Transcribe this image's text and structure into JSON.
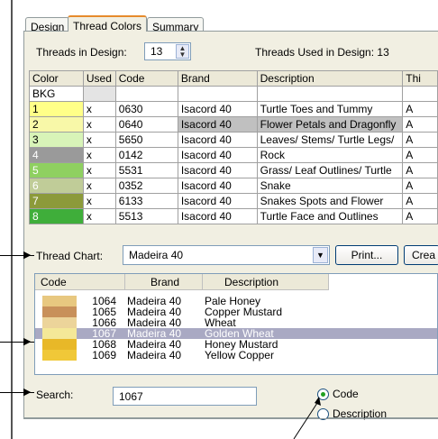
{
  "tabs": [
    "Design",
    "Thread Colors",
    "Summary"
  ],
  "threads_in_design": {
    "label": "Threads in Design:",
    "value": "13"
  },
  "threads_used": "Threads Used in Design: 13",
  "grid": {
    "headers": [
      "Color",
      "Used",
      "Code",
      "Brand",
      "Description",
      "Thi"
    ],
    "bkg_label": "BKG",
    "rows": [
      {
        "num": "1",
        "color": "#ffff88",
        "used": "x",
        "code": "0630",
        "brand": "Isacord 40",
        "desc": "Turtle Toes and Tummy",
        "thi": "A",
        "selected": false
      },
      {
        "num": "2",
        "color": "#f8f8a8",
        "used": "x",
        "code": "0640",
        "brand": "Isacord 40",
        "desc": "Flower Petals and Dragonfly",
        "thi": "A",
        "selected": true
      },
      {
        "num": "3",
        "color": "#d8f4b8",
        "used": "x",
        "code": "5650",
        "brand": "Isacord 40",
        "desc": "Leaves/ Stems/ Turtle Legs/",
        "thi": "A",
        "selected": false
      },
      {
        "num": "4",
        "color": "#9a9a9a",
        "used": "x",
        "code": "0142",
        "brand": "Isacord 40",
        "desc": "Rock",
        "thi": "A",
        "selected": false
      },
      {
        "num": "5",
        "color": "#8fd060",
        "used": "x",
        "code": "5531",
        "brand": "Isacord 40",
        "desc": "Grass/ Leaf Outlines/ Turtle",
        "thi": "A",
        "selected": false
      },
      {
        "num": "6",
        "color": "#c0cc98",
        "used": "x",
        "code": "0352",
        "brand": "Isacord 40",
        "desc": "Snake",
        "thi": "A",
        "selected": false
      },
      {
        "num": "7",
        "color": "#8c9a3a",
        "used": "x",
        "code": "6133",
        "brand": "Isacord 40",
        "desc": "Snakes Spots and Flower",
        "thi": "A",
        "selected": false
      },
      {
        "num": "8",
        "color": "#3fae3a",
        "used": "x",
        "code": "5513",
        "brand": "Isacord 40",
        "desc": "Turtle Face and Outlines",
        "thi": "A",
        "selected": false
      }
    ]
  },
  "thread_chart": {
    "label": "Thread Chart:",
    "value": "Madeira 40",
    "print_label": "Print...",
    "create_label": "Crea"
  },
  "list": {
    "headers": [
      "Code",
      "Brand",
      "Description"
    ],
    "rows": [
      {
        "color": "#e8c880",
        "code": "1064",
        "brand": "Madeira 40",
        "desc": "Pale Honey",
        "selected": false
      },
      {
        "color": "#c8905a",
        "code": "1065",
        "brand": "Madeira 40",
        "desc": "Copper Mustard",
        "selected": false
      },
      {
        "color": "#ecd49a",
        "code": "1066",
        "brand": "Madeira 40",
        "desc": "Wheat",
        "selected": false
      },
      {
        "color": "#f4e898",
        "code": "1067",
        "brand": "Madeira 40",
        "desc": "Golden Wheat",
        "selected": true
      },
      {
        "color": "#e8b828",
        "code": "1068",
        "brand": "Madeira 40",
        "desc": "Honey Mustard",
        "selected": false
      },
      {
        "color": "#f0c838",
        "code": "1069",
        "brand": "Madeira 40",
        "desc": "Yellow Copper",
        "selected": false
      }
    ]
  },
  "search": {
    "label": "Search:",
    "value": "1067"
  },
  "radio": {
    "code": "Code",
    "description": "Description"
  }
}
